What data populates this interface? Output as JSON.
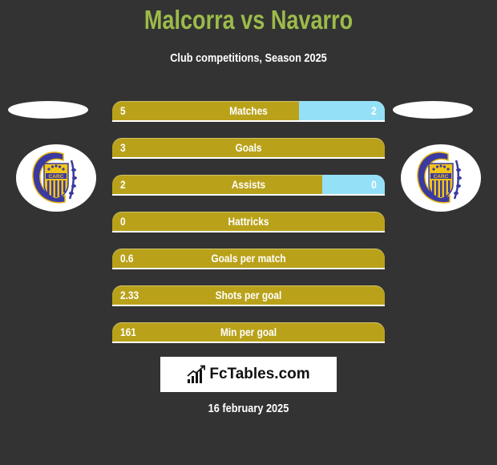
{
  "header": {
    "title": "Malcorra vs Navarro",
    "subtitle": "Club competitions, Season 2025"
  },
  "players": {
    "left": {
      "name": "Malcorra",
      "club_logo": "rosario-central-crest-icon"
    },
    "right": {
      "name": "Navarro",
      "club_logo": "rosario-central-crest-icon"
    }
  },
  "colors": {
    "title": "#9cbb4a",
    "left_bar": "#b9a21a",
    "right_bar": "#94e0f7",
    "background": "#333333"
  },
  "stats": [
    {
      "label": "Matches",
      "left": "5",
      "right": "2",
      "left_share": 0.685
    },
    {
      "label": "Goals",
      "left": "3",
      "right": "",
      "left_share": 1.0
    },
    {
      "label": "Assists",
      "left": "2",
      "right": "0",
      "left_share": 0.77
    },
    {
      "label": "Hattricks",
      "left": "0",
      "right": "",
      "left_share": 1.0
    },
    {
      "label": "Goals per match",
      "left": "0.6",
      "right": "",
      "left_share": 1.0
    },
    {
      "label": "Shots per goal",
      "left": "2.33",
      "right": "",
      "left_share": 1.0
    },
    {
      "label": "Min per goal",
      "left": "161",
      "right": "",
      "left_share": 1.0
    }
  ],
  "footer": {
    "brand": "FcTables.com",
    "brand_icon": "bar-chart-icon",
    "date": "16 february 2025"
  }
}
